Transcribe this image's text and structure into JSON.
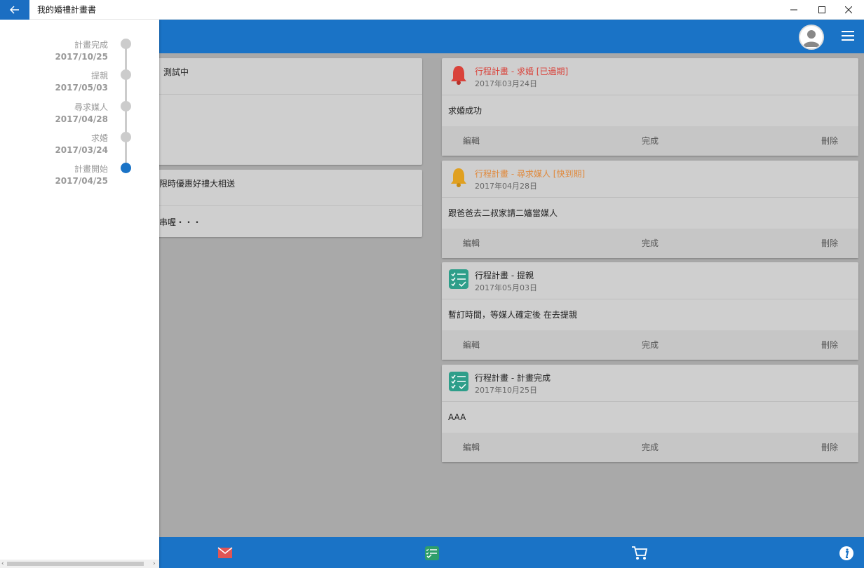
{
  "window": {
    "title": "我的婚禮計畫書"
  },
  "timeline": {
    "items": [
      {
        "label": "計畫完成",
        "date": "2017/10/25",
        "active": false
      },
      {
        "label": "提親",
        "date": "2017/05/03",
        "active": false
      },
      {
        "label": "尋求媒人",
        "date": "2017/04/28",
        "active": false
      },
      {
        "label": "求婚",
        "date": "2017/03/24",
        "active": false
      },
      {
        "label": "計畫開始",
        "date": "2017/04/25",
        "active": true
      }
    ]
  },
  "left_cards": [
    {
      "header_fragment": "測試中"
    },
    {
      "header_fragment": "限時優惠好禮大相送",
      "body_fragment": "串喔・・・"
    }
  ],
  "cards": [
    {
      "title": "行程計畫 - 求婚 [已過期]",
      "date": "2017年03月24日",
      "body": "求婚成功",
      "status": "expired",
      "icon": "bell-icon",
      "color": "#d9423a"
    },
    {
      "title": "行程計畫 - 尋求媒人 [快到期]",
      "date": "2017年04月28日",
      "body": "跟爸爸去二叔家請二嬸當媒人",
      "status": "due-soon",
      "icon": "bell-icon",
      "color": "#e0a020"
    },
    {
      "title": "行程計畫 - 提親",
      "date": "2017年05月03日",
      "body": "暫訂時間，等媒人確定後 在去提親",
      "status": "normal",
      "icon": "checklist-icon",
      "color": "#2e9e8a"
    },
    {
      "title": "行程計畫 - 計畫完成",
      "date": "2017年10月25日",
      "body": "AAA",
      "status": "normal",
      "icon": "checklist-icon",
      "color": "#2e9e8a"
    }
  ],
  "card_actions": {
    "edit": "編輯",
    "done": "完成",
    "delete": "刪除"
  },
  "bottom_nav": {
    "items": [
      "mail-icon",
      "checklist-icon",
      "cart-icon",
      "info-icon"
    ]
  }
}
